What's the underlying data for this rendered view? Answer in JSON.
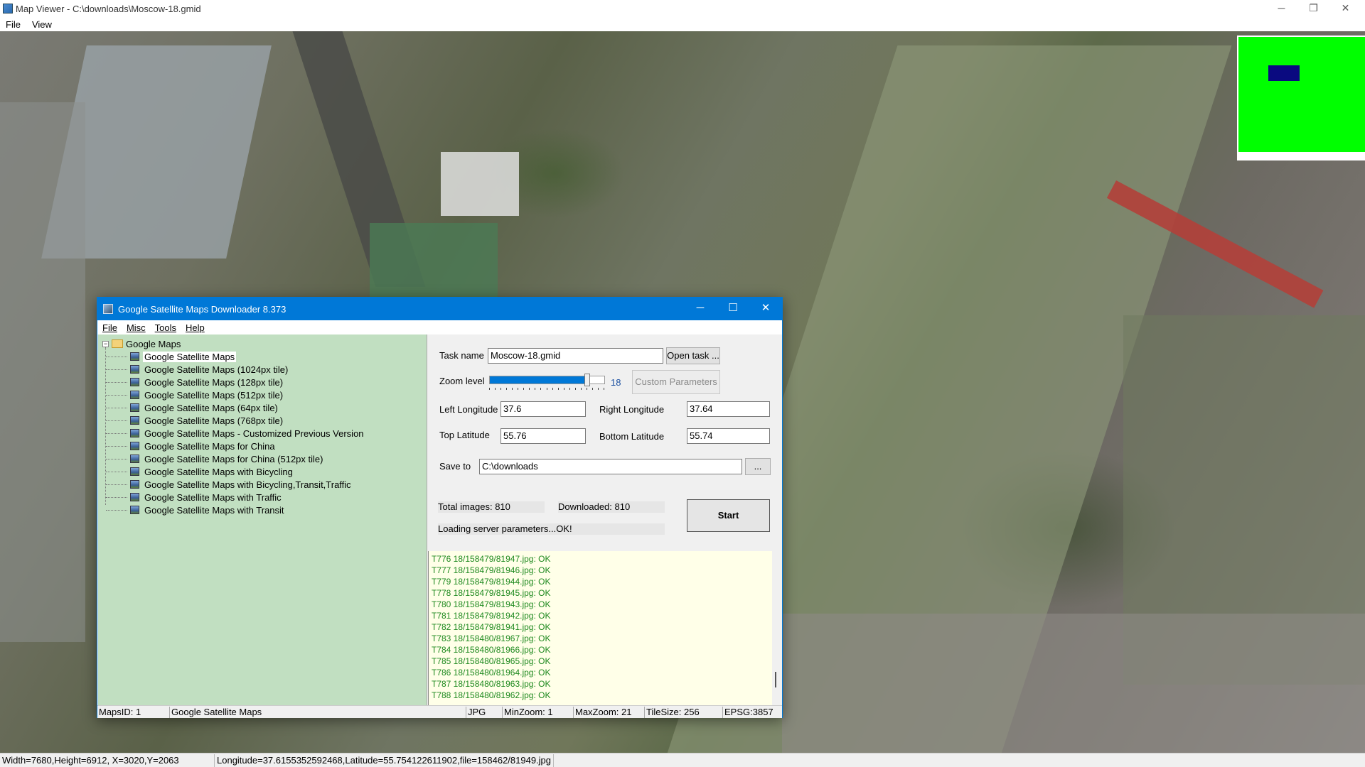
{
  "outer_window": {
    "title": "Map Viewer - C:\\downloads\\Moscow-18.gmid",
    "controls": {
      "minimize": "─",
      "restore": "❐",
      "close": "✕"
    },
    "menu": [
      "File",
      "View"
    ],
    "status": {
      "dims": "Width=7680,Height=6912, X=3020,Y=2063",
      "coords": "Longitude=37.6155352592468,Latitude=55.754122611902,file=158462/81949.jpg"
    }
  },
  "dialog": {
    "title": "Google Satellite Maps Downloader 8.373",
    "controls": {
      "minimize": "─",
      "maximize": "☐",
      "close": "✕"
    },
    "menu": [
      "File",
      "Misc",
      "Tools",
      "Help"
    ],
    "tree": {
      "root": "Google Maps",
      "expander": "−",
      "items": [
        "Google Satellite Maps",
        "Google Satellite Maps (1024px tile)",
        "Google Satellite Maps (128px tile)",
        "Google Satellite Maps (512px tile)",
        "Google Satellite Maps (64px tile)",
        "Google Satellite Maps (768px tile)",
        "Google Satellite Maps - Customized Previous Version",
        "Google Satellite Maps for China",
        "Google Satellite Maps for China (512px tile)",
        "Google Satellite Maps with Bicycling",
        "Google Satellite Maps with Bicycling,Transit,Traffic",
        "Google Satellite Maps with Traffic",
        "Google Satellite Maps with Transit"
      ],
      "selected_index": 0
    },
    "form": {
      "task_name_label": "Task name",
      "task_name_value": "Moscow-18.gmid",
      "open_task_button": "Open task ...",
      "zoom_label": "Zoom level",
      "zoom_value": "18",
      "zoom_min": 1,
      "zoom_max": 21,
      "custom_params_button": "Custom Parameters",
      "left_lon_label": "Left Longitude",
      "left_lon_value": "37.6",
      "right_lon_label": "Right Longitude",
      "right_lon_value": "37.64",
      "top_lat_label": "Top Latitude",
      "top_lat_value": "55.76",
      "bottom_lat_label": "Bottom Latitude",
      "bottom_lat_value": "55.74",
      "save_to_label": "Save to",
      "save_to_value": "C:\\downloads",
      "browse_button": "...",
      "total_images": "Total images: 810",
      "downloaded": "Downloaded: 810",
      "loading_status": "Loading server parameters...OK!",
      "start_button": "Start"
    },
    "log": [
      "T776 18/158479/81947.jpg: OK",
      "T777 18/158479/81946.jpg: OK",
      "T779 18/158479/81944.jpg: OK",
      "T778 18/158479/81945.jpg: OK",
      "T780 18/158479/81943.jpg: OK",
      "T781 18/158479/81942.jpg: OK",
      "T782 18/158479/81941.jpg: OK",
      "T783 18/158480/81967.jpg: OK",
      "T784 18/158480/81966.jpg: OK",
      "T785 18/158480/81965.jpg: OK",
      "T786 18/158480/81964.jpg: OK",
      "T787 18/158480/81963.jpg: OK",
      "T788 18/158480/81962.jpg: OK"
    ],
    "statusbar": {
      "maps_id": "MapsID: 1",
      "map_name": "Google Satellite Maps",
      "format": "JPG",
      "min_zoom": "MinZoom: 1",
      "max_zoom": "MaxZoom: 21",
      "tile_size": "TileSize: 256",
      "epsg": "EPSG:3857"
    }
  },
  "colors": {
    "dialog_accent": "#0078d7",
    "tree_bg": "#c1dfc1",
    "log_bg": "#ffffe8",
    "log_text": "#1f8a1f",
    "overview_green": "#00ff00",
    "overview_viewport": "#0a0a80"
  }
}
